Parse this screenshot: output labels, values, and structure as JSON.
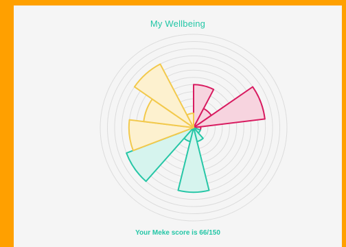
{
  "chart_data": {
    "type": "polar-area",
    "title": "My Wellbeing",
    "categories": [
      "",
      "",
      "",
      "",
      "",
      "",
      "",
      "",
      "",
      ""
    ],
    "values": [
      6,
      3,
      10,
      1,
      1,
      2,
      9,
      2,
      10,
      9,
      7,
      10,
      2
    ],
    "rmax": 13,
    "grid": true,
    "grid_rings": 13,
    "series_colors": [
      "#d81b60",
      "#d81b60",
      "#d81b60",
      "#d81b60",
      "#26c6a6",
      "#26c6a6",
      "#26c6a6",
      "#26c6a6",
      "#26c6a6",
      "#f2c94c",
      "#f2c94c",
      "#f2c94c",
      "#f2c94c"
    ],
    "series_fills": [
      "#f7d4df",
      "#f7d4df",
      "#f7d4df",
      "#f7d4df",
      "#d6f4ee",
      "#d6f4ee",
      "#d6f4ee",
      "#d6f4ee",
      "#d6f4ee",
      "#fdf1cf",
      "#fdf1cf",
      "#fdf1cf",
      "#fdf1cf"
    ]
  },
  "footer": {
    "score_text": "Your Meke score is 66/150"
  }
}
